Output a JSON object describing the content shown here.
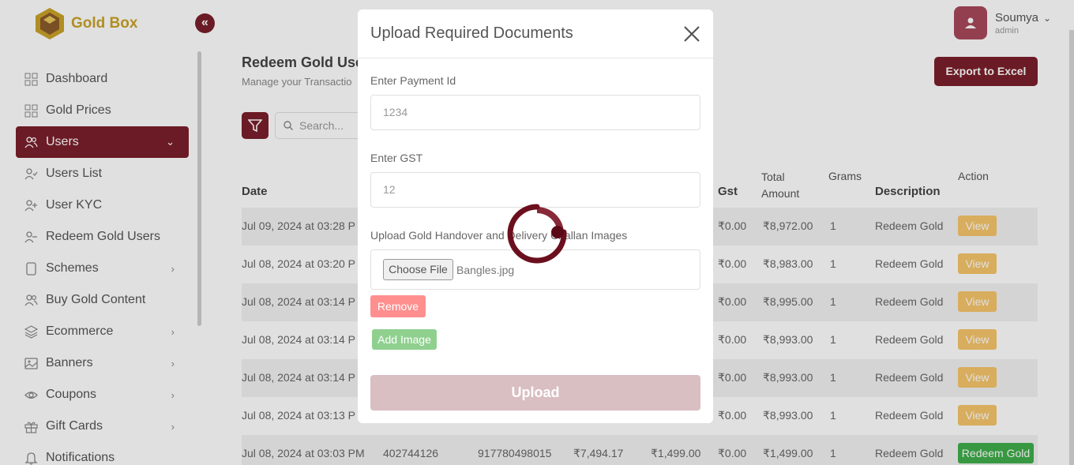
{
  "brand": {
    "name": "Gold Box"
  },
  "user": {
    "name": "Soumya",
    "role": "admin"
  },
  "sidebar": {
    "items": [
      {
        "label": "Dashboard",
        "icon": "grid-icon",
        "chevron": false
      },
      {
        "label": "Gold Prices",
        "icon": "grid-icon",
        "chevron": false
      },
      {
        "label": "Users",
        "icon": "users-icon",
        "chevron": true,
        "active": true
      },
      {
        "label": "Users List",
        "icon": "user-check-icon",
        "chevron": false
      },
      {
        "label": "User KYC",
        "icon": "user-plus-icon",
        "chevron": false
      },
      {
        "label": "Redeem Gold Users",
        "icon": "user-minus-icon",
        "chevron": false
      },
      {
        "label": "Schemes",
        "icon": "tablet-icon",
        "chevron": true
      },
      {
        "label": "Buy Gold Content",
        "icon": "users-icon",
        "chevron": false
      },
      {
        "label": "Ecommerce",
        "icon": "layers-icon",
        "chevron": true
      },
      {
        "label": "Banners",
        "icon": "image-icon",
        "chevron": true
      },
      {
        "label": "Coupons",
        "icon": "eye-icon",
        "chevron": true
      },
      {
        "label": "Gift Cards",
        "icon": "gift-icon",
        "chevron": true
      },
      {
        "label": "Notifications",
        "icon": "bell-icon",
        "chevron": false
      }
    ]
  },
  "main": {
    "title": "Redeem Gold Use",
    "subtitle": "Manage your Transactio",
    "export_label": "Export to Excel",
    "search_placeholder": "Search..."
  },
  "table": {
    "headers": {
      "date": "Date",
      "gst": "Gst",
      "total_amount": "Total\nAmount",
      "grams": "Grams",
      "description": "Description",
      "action": "Action"
    },
    "rows": [
      {
        "date": "Jul 09, 2024 at 03:28 P",
        "gst": "₹0.00",
        "total": "₹8,972.00",
        "grams": "1",
        "desc": "Redeem Gold",
        "action": "View"
      },
      {
        "date": "Jul 08, 2024 at 03:20 P",
        "gst": "₹0.00",
        "total": "₹8,983.00",
        "grams": "1",
        "desc": "Redeem Gold",
        "action": "View"
      },
      {
        "date": "Jul 08, 2024 at 03:14 P",
        "gst": "₹0.00",
        "total": "₹8,995.00",
        "grams": "1",
        "desc": "Redeem Gold",
        "action": "View"
      },
      {
        "date": "Jul 08, 2024 at 03:14 P",
        "gst": "₹0.00",
        "total": "₹8,993.00",
        "grams": "1",
        "desc": "Redeem Gold",
        "action": "View"
      },
      {
        "date": "Jul 08, 2024 at 03:14 P",
        "gst": "₹0.00",
        "total": "₹8,993.00",
        "grams": "1",
        "desc": "Redeem Gold",
        "action": "View"
      },
      {
        "date": "Jul 08, 2024 at 03:13 P",
        "gst": "₹0.00",
        "total": "₹8,993.00",
        "grams": "1",
        "desc": "Redeem Gold",
        "action": "View"
      },
      {
        "date": "Jul 08, 2024 at 03:03 PM",
        "payment_id": "402744126",
        "phone": "917780498015",
        "amount": "₹7,494.17",
        "price": "₹1,499.00",
        "gst": "₹0.00",
        "total": "₹1,499.00",
        "grams": "1",
        "desc": "Redeem Gold",
        "action": "Redeem Gold"
      }
    ]
  },
  "modal": {
    "title": "Upload Required Documents",
    "payment_label": "Enter Payment Id",
    "payment_value": "1234",
    "gst_label": "Enter GST",
    "gst_value": "12",
    "images_label": "Upload Gold Handover and Delivery Challan Images",
    "choose_file_label": "Choose File",
    "file_name": "Bangles.jpg",
    "remove_label": "Remove",
    "add_image_label": "Add Image",
    "upload_label": "Upload"
  },
  "colors": {
    "brand": "#7a1f2b",
    "gold": "#c9a227",
    "view": "#f6c56a",
    "redeem": "#3fae4b",
    "remove": "#ff8f8f",
    "add": "#8fd08f",
    "upload": "#d9bec2"
  }
}
